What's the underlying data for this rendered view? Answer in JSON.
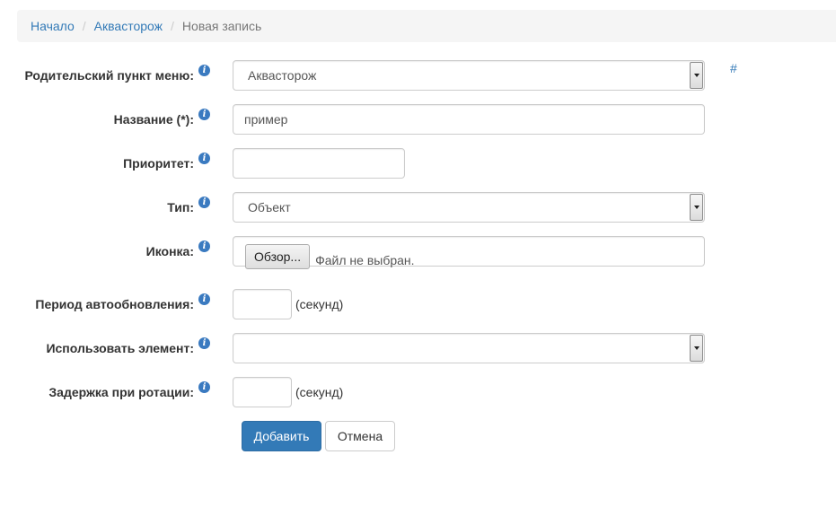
{
  "breadcrumb": {
    "home": "Начало",
    "section": "Аквасторож",
    "current": "Новая запись",
    "separator": "/"
  },
  "form": {
    "hash_link": "#",
    "parent_menu": {
      "label": "Родительский пункт меню:",
      "value": "Аквасторож"
    },
    "name": {
      "label": "Название (*):",
      "value": "пример"
    },
    "priority": {
      "label": "Приоритет:",
      "value": ""
    },
    "type": {
      "label": "Тип:",
      "value": "Объект"
    },
    "icon": {
      "label": "Иконка:",
      "browse_label": "Обзор...",
      "file_status": "Файл не выбран."
    },
    "refresh_period": {
      "label": "Период автообновления:",
      "value": "",
      "unit": "(секунд)"
    },
    "use_element": {
      "label": "Использовать элемент:",
      "value": ""
    },
    "rotation_delay": {
      "label": "Задержка при ротации:",
      "value": "",
      "unit": "(секунд)"
    },
    "info_glyph": "i"
  },
  "actions": {
    "submit_label": "Добавить",
    "cancel_label": "Отмена"
  },
  "colors": {
    "link": "#337ab7",
    "primary_button": "#337ab7",
    "info_icon": "#3a7ac0",
    "breadcrumb_bg": "#f5f5f5"
  }
}
